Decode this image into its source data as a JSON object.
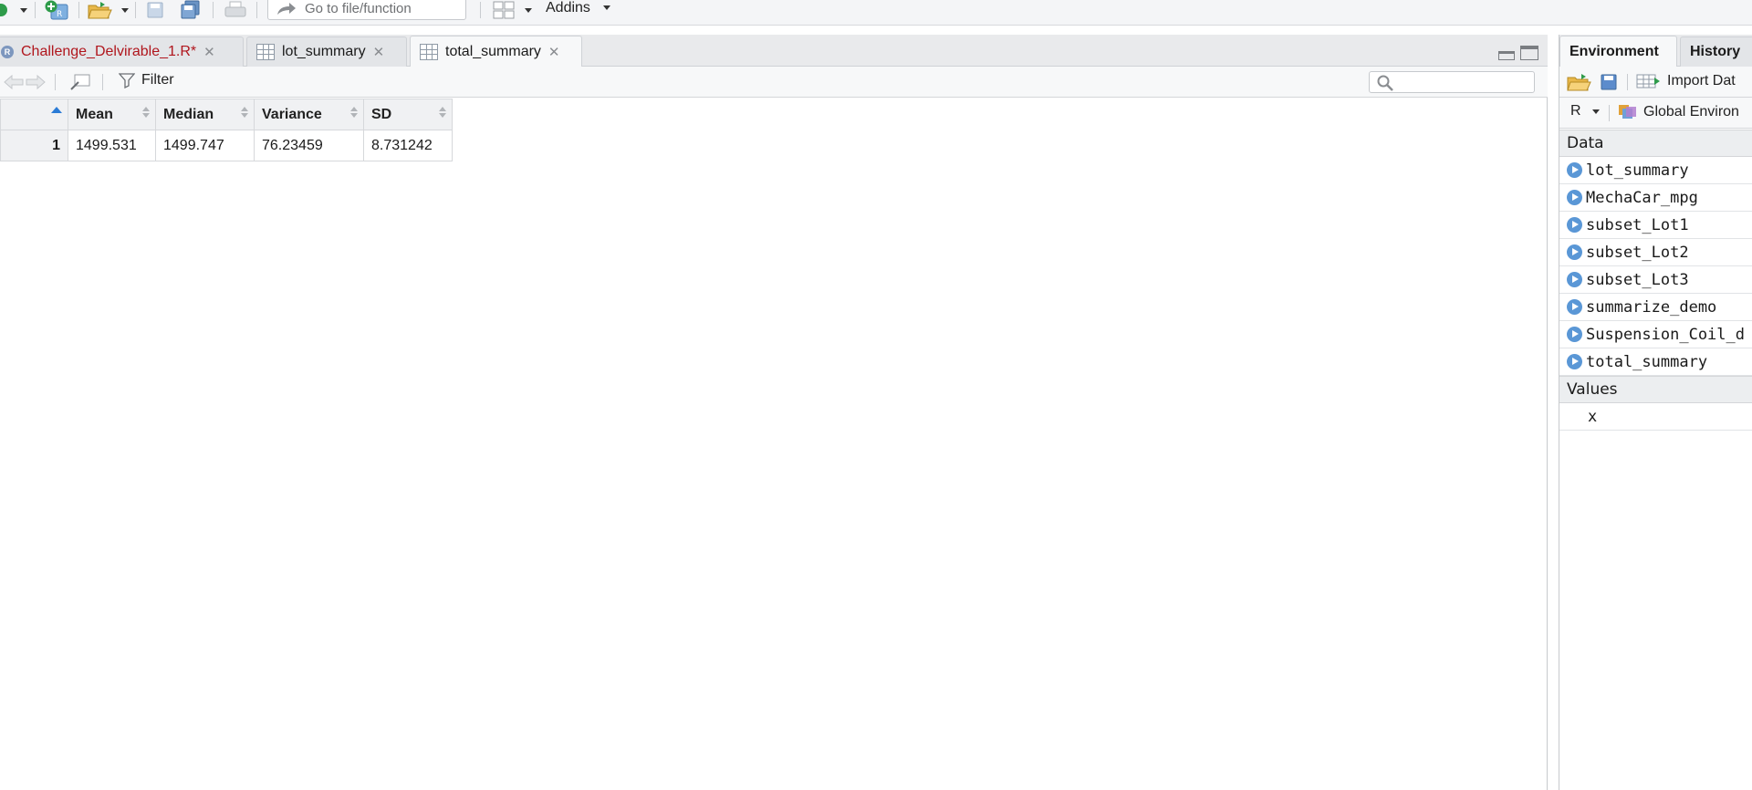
{
  "toolbar": {
    "goto_placeholder": "Go to file/function",
    "addins_label": "Addins"
  },
  "editor": {
    "tabs": [
      {
        "label": "Challenge_Delvirable_1.R*",
        "type": "r-script",
        "modified": true
      },
      {
        "label": "lot_summary",
        "type": "data-viewer"
      },
      {
        "label": "total_summary",
        "type": "data-viewer",
        "active": true
      }
    ],
    "filter_label": "Filter"
  },
  "table": {
    "columns": [
      "Mean",
      "Median",
      "Variance",
      "SD"
    ],
    "rows": [
      {
        "index": "1",
        "cells": [
          "1499.531",
          "1499.747",
          "76.23459",
          "8.731242"
        ]
      }
    ]
  },
  "environment": {
    "tabs": [
      "Environment",
      "History"
    ],
    "import_label": "Import Dat",
    "language": "R",
    "scope_label": "Global Environ",
    "data_header": "Data",
    "data_items": [
      "lot_summary",
      "MechaCar_mpg",
      "subset_Lot1",
      "subset_Lot2",
      "subset_Lot3",
      "summarize_demo",
      "Suspension_Coil_d",
      "total_summary"
    ],
    "values_header": "Values",
    "value_items": [
      "x"
    ]
  },
  "colors": {
    "modified_tab_text": "#b0161d",
    "sort_active": "#2b7bd6",
    "data_icon": "#5a97d6"
  }
}
